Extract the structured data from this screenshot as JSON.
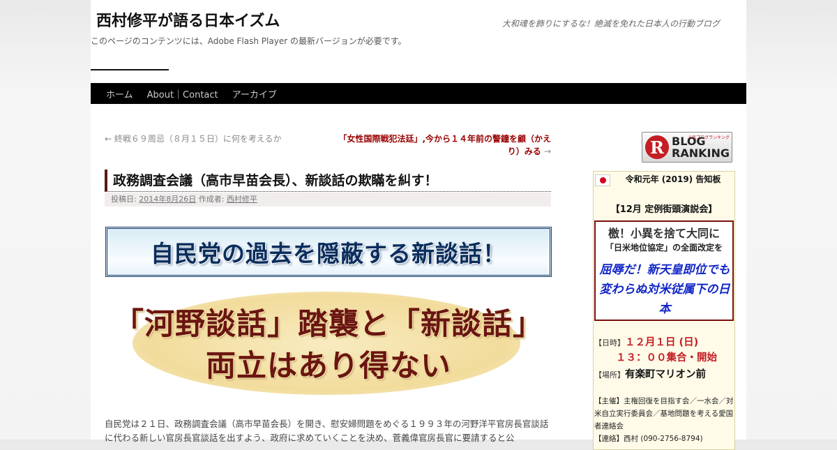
{
  "site": {
    "title": "西村修平が語る日本イズム",
    "description": "大和魂を飾りにするな！絶滅を免れた日本人の行動ブログ",
    "flash_notice": "このページのコンテンツには、Adobe Flash Player の最新バージョンが必要です。"
  },
  "nav": {
    "home": "ホーム",
    "about": "About｜Contact",
    "archive": "アーカイブ"
  },
  "post_nav": {
    "prev": "← 終戦６９周忌（８月１５日）に何を考えるか",
    "next": "「女性国際戦犯法廷」,今から１４年前の警鐘を顧（かえり）みる",
    "next_arrow": "→"
  },
  "post": {
    "title": "政務調査会議（高市早苗会長）、新談話の欺瞞を糾す！",
    "meta_posted": "投稿日:",
    "meta_date": "2014年8月26日",
    "meta_author_label": "作成者:",
    "meta_author": "西村修平",
    "banner": "自民党の過去を隠蔽する新談話！",
    "dispute_line1": "「河野談話」踏襲と「新談話」",
    "dispute_line2": "両立はあり得ない",
    "body": "自民党は２１日、政務調査会議（高市早苗会長）を開き、慰安婦問題をめぐる１９９３年の河野洋平官房長官談話に代わる新しい官房長官談話を出すよう、政府に求めていくことを決め、菅義偉官房長官に要請すると公"
  },
  "sidebar": {
    "rank_letter": "R",
    "rank_word1": "BLOG",
    "rank_word2": "RANKING",
    "rank_small": "人気ブログランキング",
    "notice": "令和元年 (2019) 告知板",
    "event": "【12月 定例街頭演説会】",
    "slogan1": "檄！小異を捨て大同に",
    "slogan2": "「日米地位協定」の全面改定を",
    "slogan3": "屈辱だ！新天皇即位でも変わらぬ対米従属下の日本",
    "date_label": "【日時】",
    "date_value": "１２月１日 (日)",
    "time_value": "１３：００集合・開始",
    "place_label": "【場所】",
    "place_value": "有楽町マリオン前",
    "organizer": "【主催】主権回復を目指す会／一水会／対米自立実行委員会／基地問題を考える愛国者連絡会",
    "contact": "【連絡】西村 (090-2756-8794)"
  }
}
